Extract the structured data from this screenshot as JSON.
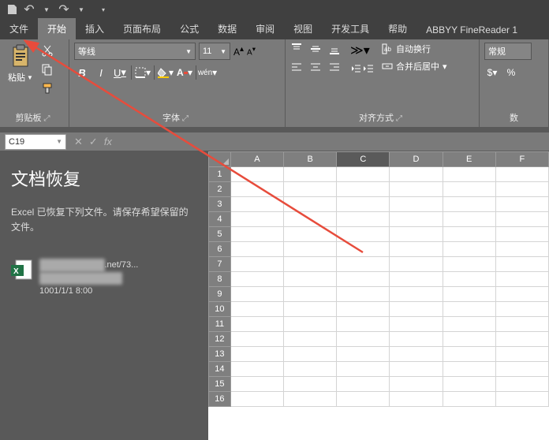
{
  "qat": {
    "save": "💾",
    "undo": "↶",
    "redo": "↷"
  },
  "tabs": {
    "file": "文件",
    "home": "开始",
    "insert": "插入",
    "layout": "页面布局",
    "formulas": "公式",
    "data": "数据",
    "review": "审阅",
    "view": "视图",
    "dev": "开发工具",
    "help": "帮助",
    "abbyy": "ABBYY FineReader 1"
  },
  "ribbon": {
    "clipboard": {
      "paste": "粘贴",
      "label": "剪贴板"
    },
    "font": {
      "name": "等线",
      "size": "11",
      "B": "B",
      "I": "I",
      "U": "U",
      "label": "字体",
      "wen": "wén"
    },
    "align": {
      "wrap": "自动换行",
      "merge": "合并后居中",
      "label": "对齐方式"
    },
    "number": {
      "general": "常规",
      "label": "数"
    }
  },
  "formula_bar": {
    "cell_ref": "C19",
    "x": "✕",
    "check": "✓",
    "fx": "fx"
  },
  "recovery": {
    "title": "文档恢复",
    "msg": "Excel 已恢复下列文件。请保存希望保留的文件。",
    "doc_line3": "1001/1/1 8:00",
    "doc_suffix": ".net/73..."
  },
  "sheet": {
    "cols": [
      "A",
      "B",
      "C",
      "D",
      "E",
      "F"
    ],
    "rows": [
      1,
      2,
      3,
      4,
      5,
      6,
      7,
      8,
      9,
      10,
      11,
      12,
      13,
      14,
      15,
      16
    ],
    "active_col": "C"
  }
}
